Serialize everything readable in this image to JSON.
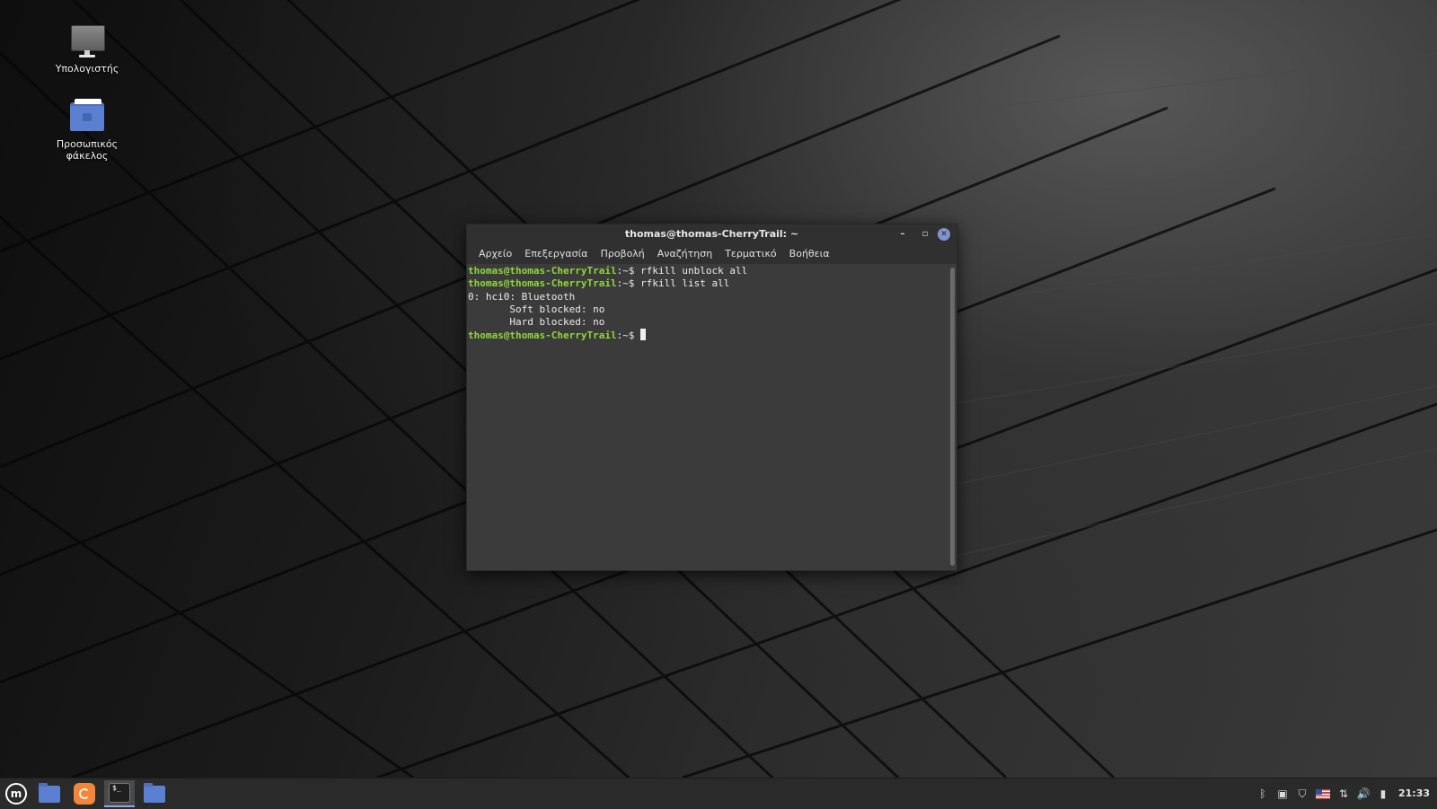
{
  "desktop": {
    "icons": [
      {
        "label": "Υπολογιστής",
        "icon": "computer-icon"
      },
      {
        "label": "Προσωπικός φάκελος",
        "icon": "home-folder-icon"
      }
    ]
  },
  "terminal": {
    "title": "thomas@thomas-CherryTrail: ~",
    "menu": [
      "Αρχείο",
      "Επεξεργασία",
      "Προβολή",
      "Αναζήτηση",
      "Τερματικό",
      "Βοήθεια"
    ],
    "prompt_user": "thomas@thomas-CherryTrail",
    "prompt_suffix": ":~$ ",
    "lines": [
      {
        "type": "prompt",
        "command": "rfkill unblock all"
      },
      {
        "type": "prompt",
        "command": "rfkill list all"
      },
      {
        "type": "output",
        "text": "0: hci0: Bluetooth"
      },
      {
        "type": "output",
        "text": "\tSoft blocked: no"
      },
      {
        "type": "output",
        "text": "\tHard blocked: no"
      },
      {
        "type": "prompt",
        "command": ""
      }
    ]
  },
  "taskbar": {
    "launchers": [
      {
        "name": "menu-button",
        "icon": "linux-mint-icon"
      },
      {
        "name": "files-launcher",
        "icon": "folder-icon"
      },
      {
        "name": "firefox-launcher",
        "icon": "firefox-icon"
      },
      {
        "name": "terminal-launcher",
        "icon": "terminal-icon",
        "active": true
      },
      {
        "name": "files-window",
        "icon": "folder-icon"
      }
    ],
    "tray_icons": [
      "bluetooth-icon",
      "clipboard-icon",
      "shield-icon",
      "us-flag-icon",
      "network-icon",
      "volume-icon",
      "battery-icon"
    ],
    "clock": "21:33"
  }
}
